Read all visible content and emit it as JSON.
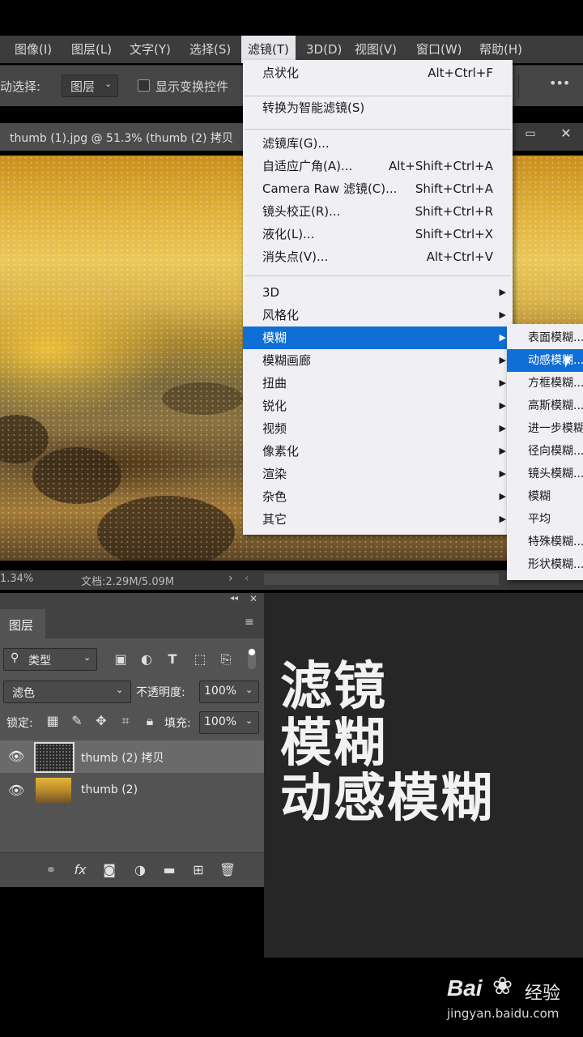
{
  "menubar": {
    "items": [
      "图像(I)",
      "图层(L)",
      "文字(Y)",
      "选择(S)",
      "滤镜(T)",
      "3D(D)",
      "视图(V)",
      "窗口(W)",
      "帮助(H)"
    ]
  },
  "options_bar": {
    "auto_select_label": "动选择:",
    "layer_select_value": "图层",
    "show_transform_label": "显示变换控件",
    "more_icon": "•••"
  },
  "document": {
    "tab_title": "thumb (1).jpg @ 51.3% (thumb (2) 拷贝",
    "window_controls": [
      "▭",
      "✕"
    ]
  },
  "status_bar": {
    "zoom": "1.34%",
    "doc_size": "文档:2.29M/5.09M"
  },
  "filter_menu": {
    "items": [
      {
        "label": "点状化",
        "shortcut": "Alt+Ctrl+F"
      },
      {
        "label": "转换为智能滤镜(S)",
        "shortcut": ""
      },
      {
        "label": "滤镜库(G)...",
        "shortcut": ""
      },
      {
        "label": "自适应广角(A)...",
        "shortcut": "Alt+Shift+Ctrl+A"
      },
      {
        "label": "Camera Raw 滤镜(C)...",
        "shortcut": "Shift+Ctrl+A"
      },
      {
        "label": "镜头校正(R)...",
        "shortcut": "Shift+Ctrl+R"
      },
      {
        "label": "液化(L)...",
        "shortcut": "Shift+Ctrl+X"
      },
      {
        "label": "消失点(V)...",
        "shortcut": "Alt+Ctrl+V"
      },
      {
        "label": "3D"
      },
      {
        "label": "风格化"
      },
      {
        "label": "模糊",
        "highlighted": true
      },
      {
        "label": "模糊画廊"
      },
      {
        "label": "扭曲"
      },
      {
        "label": "锐化"
      },
      {
        "label": "视频"
      },
      {
        "label": "像素化"
      },
      {
        "label": "渲染"
      },
      {
        "label": "杂色"
      },
      {
        "label": "其它"
      }
    ],
    "arrow": "▶"
  },
  "blur_submenu": {
    "items": [
      {
        "label": "表面模糊..."
      },
      {
        "label": "动感模糊...",
        "highlighted": true
      },
      {
        "label": "方框模糊..."
      },
      {
        "label": "高斯模糊..."
      },
      {
        "label": "进一步模糊"
      },
      {
        "label": "径向模糊..."
      },
      {
        "label": "镜头模糊..."
      },
      {
        "label": "模糊"
      },
      {
        "label": "平均"
      },
      {
        "label": "特殊模糊..."
      },
      {
        "label": "形状模糊..."
      }
    ]
  },
  "layers_panel": {
    "tab_label": "图层",
    "filter_kind": "类型",
    "blend_mode": "滤色",
    "opacity_label": "不透明度:",
    "opacity_value": "100%",
    "lock_label": "锁定:",
    "fill_label": "填充:",
    "fill_value": "100%",
    "layers": [
      {
        "name": "thumb (2) 拷贝",
        "selected": true
      },
      {
        "name": "thumb (2)",
        "selected": false
      }
    ],
    "footer_icons": [
      "link-icon",
      "fx-icon",
      "mask-icon",
      "adjustment-icon",
      "folder-icon",
      "new-layer-icon",
      "trash-icon"
    ]
  },
  "overlay_text": {
    "line1": "滤镜",
    "line2": "模糊",
    "line3": "动感模糊"
  },
  "watermark": {
    "brand": "Bai",
    "brand_suffix": "经验",
    "url": "jingyan.baidu.com"
  }
}
